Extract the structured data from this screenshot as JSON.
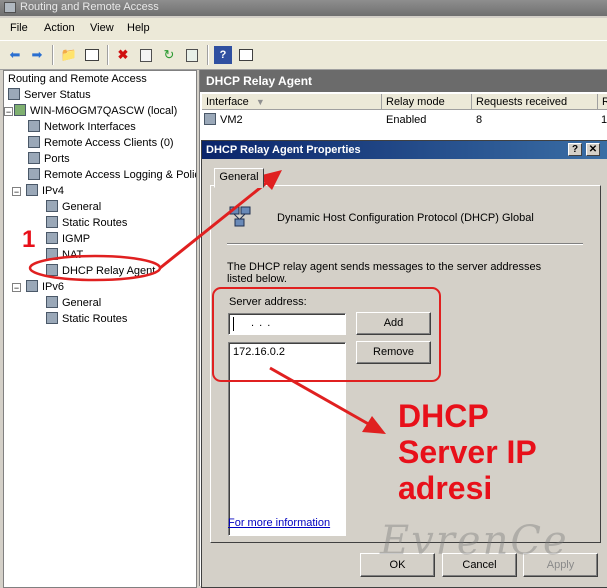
{
  "window": {
    "title": "Routing and Remote Access"
  },
  "menu": {
    "file": "File",
    "action": "Action",
    "view": "View",
    "help": "Help"
  },
  "tree": {
    "root": "Routing and Remote Access",
    "server_status": "Server Status",
    "server": "WIN-M6OGM7QASCW (local)",
    "network_interfaces": "Network Interfaces",
    "remote_access_clients": "Remote Access Clients (0)",
    "ports": "Ports",
    "remote_access_logging": "Remote Access Logging & Polic",
    "ipv4": "IPv4",
    "ipv4_general": "General",
    "ipv4_static_routes": "Static Routes",
    "igmp": "IGMP",
    "nat": "NAT",
    "dhcp_relay_agent": "DHCP Relay Agent",
    "ipv6": "IPv6",
    "ipv6_general": "General",
    "ipv6_static_routes": "Static Routes"
  },
  "right_pane": {
    "header": "DHCP Relay Agent",
    "columns": {
      "interface": "Interface",
      "relay_mode": "Relay mode",
      "requests_received": "Requests received",
      "extra": "R"
    },
    "row": {
      "interface": "VM2",
      "relay_mode": "Enabled",
      "requests_received": "8",
      "extra": "1"
    }
  },
  "dialog": {
    "title": "DHCP Relay Agent Properties",
    "help_glyph": "?",
    "close_glyph": "✕",
    "tab_general": "General",
    "description_title": "Dynamic Host Configuration Protocol (DHCP) Global",
    "info_text": "The DHCP relay agent sends messages to the server addresses listed below.",
    "server_address_label": "Server address:",
    "server_address_input": ".       .       .",
    "add_button": "Add",
    "remove_button": "Remove",
    "server_list": [
      "172.16.0.2"
    ],
    "more_info_link": "For more information",
    "ok_button": "OK",
    "cancel_button": "Cancel",
    "apply_button": "Apply"
  },
  "annotations": {
    "step_number": "1",
    "callout_line1": "DHCP",
    "callout_line2": "Server IP",
    "callout_line3": "adresi",
    "watermark": "EvrenCe"
  },
  "colors": {
    "annotation_red": "#e8101a",
    "title_blue": "#0a246a",
    "pane_header": "#6b6b6b"
  }
}
